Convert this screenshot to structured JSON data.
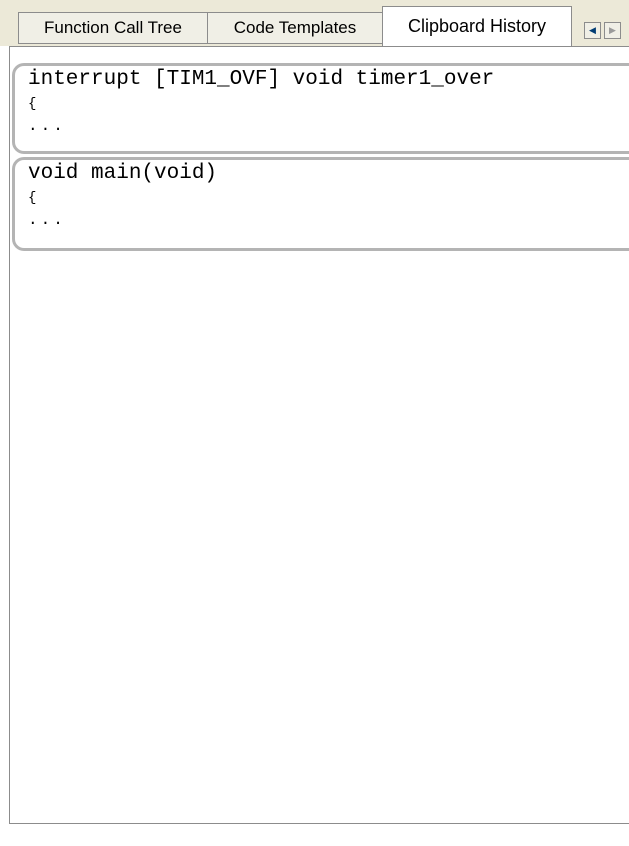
{
  "tabs": [
    {
      "label": "Function Call Tree",
      "active": false
    },
    {
      "label": "Code Templates",
      "active": false
    },
    {
      "label": "Clipboard History",
      "active": true
    }
  ],
  "tab_scroll": {
    "left_icon": "scroll-left-arrow-icon",
    "right_icon": "scroll-right-arrow-icon"
  },
  "clipboard_items": [
    {
      "lines": [
        "interrupt [TIM1_OVF] void timer1_over",
        "{",
        "..."
      ]
    },
    {
      "lines": [
        "void main(void)",
        "{",
        "..."
      ]
    }
  ],
  "colors": {
    "tab_bg": "#f0efe6",
    "border": "#b4b4b4",
    "background": "#ffffff"
  }
}
